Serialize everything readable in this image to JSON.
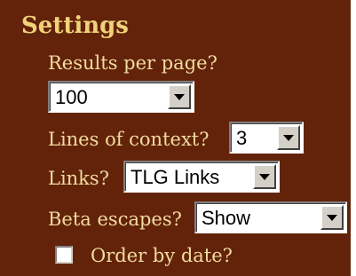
{
  "settings": {
    "title": "Settings",
    "results_per_page": {
      "label": "Results per page?",
      "value": "100"
    },
    "lines_of_context": {
      "label": "Lines of context?",
      "value": "3"
    },
    "links": {
      "label": "Links?",
      "value": "TLG Links"
    },
    "beta_escapes": {
      "label": "Beta escapes?",
      "value": "Show"
    },
    "order_by_date": {
      "label": "Order by date?",
      "checked": false
    }
  },
  "colors": {
    "panel_bg": "#63230a",
    "title": "#f0d27a",
    "label": "#f2dca0"
  }
}
